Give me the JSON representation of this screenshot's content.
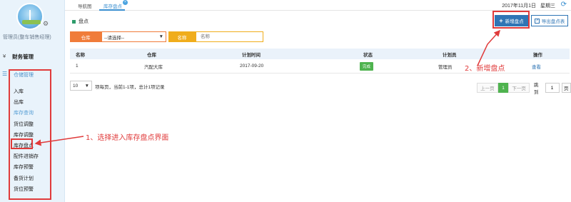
{
  "sidebar": {
    "admin_label": "管理员(整车销售经理)",
    "finance_label": "财务管理",
    "warehouse_title": "仓储管理",
    "items": [
      {
        "label": "入库",
        "dim": false
      },
      {
        "label": "出库",
        "dim": false
      },
      {
        "label": "库存查询",
        "dim": true
      },
      {
        "label": "货位调整",
        "dim": false
      },
      {
        "label": "库存调整",
        "dim": false
      },
      {
        "label": "库存盘点",
        "dim": false
      },
      {
        "label": "配件进销存",
        "dim": false
      },
      {
        "label": "库存预警",
        "dim": false
      },
      {
        "label": "备货计划",
        "dim": false
      },
      {
        "label": "货位预警",
        "dim": false
      }
    ]
  },
  "topbar": {
    "tab_home": "导航图",
    "tab_stock": "库存盘点",
    "close_glyph": "×",
    "date": "2017年11月1日",
    "weekday": "星期三"
  },
  "breadcrumb": "盘点",
  "buttons": {
    "new_label": "新增盘点",
    "export_label": "导出盘点表"
  },
  "filters": {
    "warehouse_label": "仓库",
    "warehouse_value": "--请选择--",
    "name_label": "名称",
    "name_placeholder": "名称"
  },
  "table": {
    "columns": [
      "名称",
      "仓库",
      "计划时间",
      "状态",
      "计划员",
      "操作"
    ],
    "rows": [
      {
        "name": "1",
        "warehouse": "汽配大库",
        "plan_time": "2017-09-20",
        "status": "完成",
        "planner": "管理员",
        "action": "查看"
      }
    ]
  },
  "pagination": {
    "page_size": "10",
    "info": "项每页，当前1-1项，总计1项记录",
    "prev": "上一页",
    "current": "1",
    "next": "下一页",
    "jump_label": "跳到",
    "jump_value": "1",
    "go": "页"
  },
  "annotations": {
    "step1": "1、选择进入库存盘点界面",
    "step2": "2、新增盘点"
  },
  "colors": {
    "accent": "#2f75b5",
    "annotation_red": "#e03b3b",
    "status_green": "#4fb34f",
    "warehouse_orange": "#f07c3a",
    "name_yellow": "#f0ad1c"
  },
  "icons": {
    "gear": "gear-icon",
    "yen": "yen-icon",
    "database": "database-icon",
    "refresh": "refresh-icon",
    "plus": "plus-icon",
    "export": "export-icon",
    "dropdown": "chevron-down-icon"
  }
}
